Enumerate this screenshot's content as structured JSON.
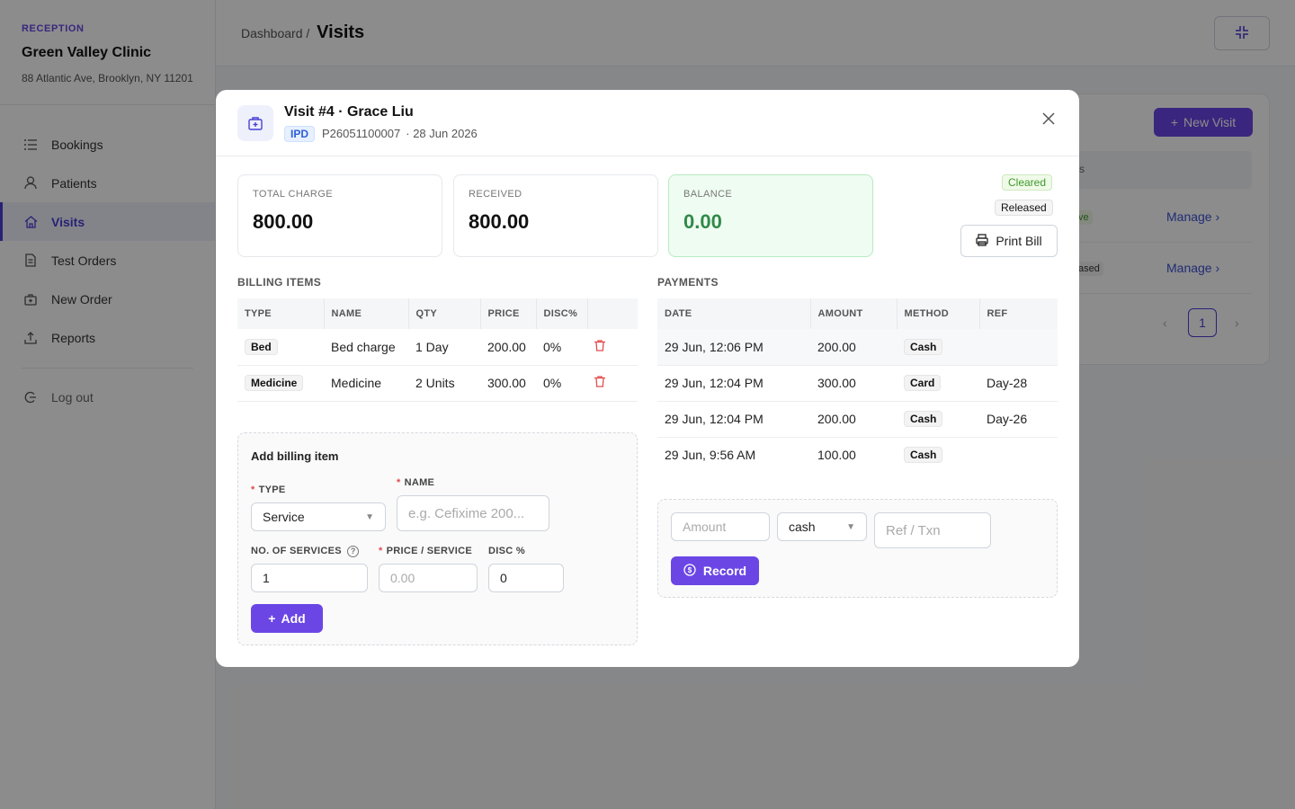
{
  "sidebar": {
    "role": "RECEPTION",
    "clinic": "Green Valley Clinic",
    "address": "88 Atlantic Ave, Brooklyn, NY 11201",
    "items": [
      {
        "label": "Bookings",
        "icon": "list-icon"
      },
      {
        "label": "Patients",
        "icon": "user-icon"
      },
      {
        "label": "Visits",
        "icon": "home-icon"
      },
      {
        "label": "Test Orders",
        "icon": "document-icon"
      },
      {
        "label": "New Order",
        "icon": "medkit-icon"
      },
      {
        "label": "Reports",
        "icon": "upload-icon"
      }
    ],
    "logout": "Log out"
  },
  "header": {
    "breadcrumb_parent": "Dashboard /",
    "breadcrumb_current": "Visits"
  },
  "background": {
    "new_visit": "New Visit",
    "col_fragment": "s",
    "badge_active": "ve",
    "badge_released": "ased",
    "manage": "Manage",
    "page": "1"
  },
  "modal": {
    "title": "Visit #4 · Grace Liu",
    "visit_type": "IPD",
    "patient_id": "P26051100007",
    "date": "· 28 Jun 2026",
    "stats": {
      "total_label": "TOTAL CHARGE",
      "total_value": "800.00",
      "received_label": "RECEIVED",
      "received_value": "800.00",
      "balance_label": "BALANCE",
      "balance_value": "0.00"
    },
    "status_cleared": "Cleared",
    "status_released": "Released",
    "print_bill": "Print Bill",
    "billing": {
      "title": "BILLING ITEMS",
      "headers": [
        "TYPE",
        "NAME",
        "QTY",
        "PRICE",
        "DISC%"
      ],
      "rows": [
        {
          "type": "Bed",
          "name": "Bed charge",
          "qty": "1 Day",
          "price": "200.00",
          "disc": "0%"
        },
        {
          "type": "Medicine",
          "name": "Medicine",
          "qty": "2 Units",
          "price": "300.00",
          "disc": "0%"
        }
      ]
    },
    "add_item": {
      "title": "Add billing item",
      "type_label": "TYPE",
      "type_value": "Service",
      "name_label": "NAME",
      "name_placeholder": "e.g. Cefixime 200...",
      "count_label": "NO. OF SERVICES",
      "count_value": "1",
      "price_label": "PRICE / SERVICE",
      "price_placeholder": "0.00",
      "disc_label": "DISC %",
      "disc_value": "0",
      "add_button": "Add"
    },
    "payments": {
      "title": "PAYMENTS",
      "headers": [
        "DATE",
        "AMOUNT",
        "METHOD",
        "REF"
      ],
      "rows": [
        {
          "date": "29 Jun, 12:06 PM",
          "amount": "200.00",
          "method": "Cash",
          "ref": ""
        },
        {
          "date": "29 Jun, 12:04 PM",
          "amount": "300.00",
          "method": "Card",
          "ref": "Day-28"
        },
        {
          "date": "29 Jun, 12:04 PM",
          "amount": "200.00",
          "method": "Cash",
          "ref": "Day-26"
        },
        {
          "date": "29 Jun, 9:56 AM",
          "amount": "100.00",
          "method": "Cash",
          "ref": ""
        }
      ],
      "amount_placeholder": "Amount",
      "method_value": "cash",
      "ref_placeholder": "Ref / Txn",
      "record_button": "Record"
    }
  },
  "colors": {
    "accent": "#6b46e5",
    "active_nav": "#4a3fd4",
    "balance_green": "#2f8a48",
    "delete_red": "#e24c4c"
  }
}
